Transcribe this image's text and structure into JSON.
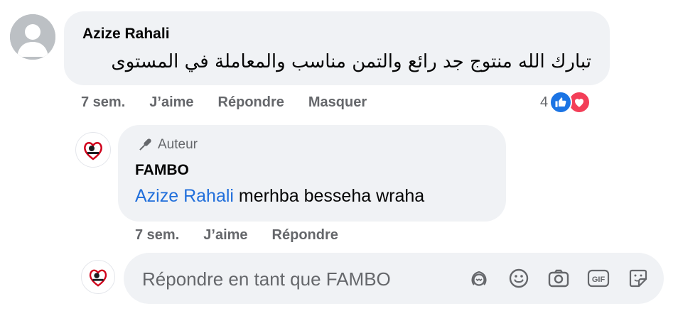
{
  "comment": {
    "author": "Azize Rahali",
    "text": "تبارك الله منتوج جد رائع والتمن مناسب والمعاملة في المستوى",
    "time": "7 sem.",
    "like_label": "J’aime",
    "reply_label": "Répondre",
    "hide_label": "Masquer",
    "reaction_count": "4",
    "reaction_icons": [
      "like-icon",
      "love-icon"
    ],
    "colors": {
      "like": "#1b74e4",
      "love": "#f33e58"
    }
  },
  "reply": {
    "badge_label": "Auteur",
    "badge_icon": "microphone-icon",
    "author": "FAMBO",
    "mention": "Azize Rahali",
    "text": " merhba besseha wraha",
    "time": "7 sem.",
    "like_label": "J’aime",
    "reply_label": "Répondre"
  },
  "composer": {
    "placeholder": "Répondre en tant que FAMBO",
    "icons": [
      "avatar-sticker-icon",
      "emoji-icon",
      "camera-icon",
      "gif-icon",
      "sticker-icon"
    ],
    "gif_label": "GIF"
  },
  "colors": {
    "bubble_bg": "#f0f2f5",
    "secondary_text": "#65676b",
    "mention": "#216fdb"
  }
}
